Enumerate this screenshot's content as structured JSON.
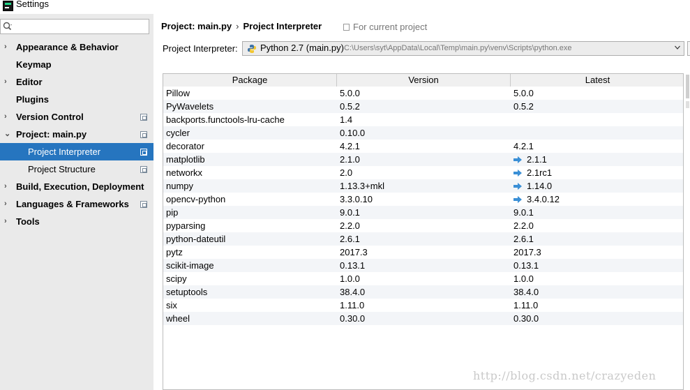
{
  "window": {
    "title": "Settings"
  },
  "search": {
    "value": "",
    "placeholder": ""
  },
  "sidebar": {
    "items": [
      {
        "label": "Appearance & Behavior",
        "arrow": "›"
      },
      {
        "label": "Keymap",
        "arrow": ""
      },
      {
        "label": "Editor",
        "arrow": "›"
      },
      {
        "label": "Plugins",
        "arrow": ""
      },
      {
        "label": "Version Control",
        "arrow": "›"
      },
      {
        "label": "Project: main.py",
        "arrow": "⌄"
      },
      {
        "label": "Project Interpreter",
        "arrow": ""
      },
      {
        "label": "Project Structure",
        "arrow": ""
      },
      {
        "label": "Build, Execution, Deployment",
        "arrow": "›"
      },
      {
        "label": "Languages & Frameworks",
        "arrow": "›"
      },
      {
        "label": "Tools",
        "arrow": "›"
      }
    ],
    "selected": "Project Interpreter"
  },
  "header": {
    "crumb1": "Project: main.py",
    "separator": "›",
    "crumb2": "Project Interpreter",
    "scope_hint": "For current project"
  },
  "interpreter": {
    "label": "Project Interpreter:",
    "name": "Python 2.7 (main.py)",
    "path": "C:\\Users\\syt\\AppData\\Local\\Temp\\main.py\\venv\\Scripts\\python.exe"
  },
  "table": {
    "columns": [
      "Package",
      "Version",
      "Latest"
    ],
    "rows": [
      {
        "package": "Pillow",
        "version": "5.0.0",
        "latest": "5.0.0",
        "upgrade": false
      },
      {
        "package": "PyWavelets",
        "version": "0.5.2",
        "latest": "0.5.2",
        "upgrade": false
      },
      {
        "package": "backports.functools-lru-cache",
        "version": "1.4",
        "latest": "",
        "upgrade": false
      },
      {
        "package": "cycler",
        "version": "0.10.0",
        "latest": "",
        "upgrade": false
      },
      {
        "package": "decorator",
        "version": "4.2.1",
        "latest": "4.2.1",
        "upgrade": false
      },
      {
        "package": "matplotlib",
        "version": "2.1.0",
        "latest": "2.1.1",
        "upgrade": true
      },
      {
        "package": "networkx",
        "version": "2.0",
        "latest": "2.1rc1",
        "upgrade": true
      },
      {
        "package": "numpy",
        "version": "1.13.3+mkl",
        "latest": "1.14.0",
        "upgrade": true
      },
      {
        "package": "opencv-python",
        "version": "3.3.0.10",
        "latest": "3.4.0.12",
        "upgrade": true
      },
      {
        "package": "pip",
        "version": "9.0.1",
        "latest": "9.0.1",
        "upgrade": false
      },
      {
        "package": "pyparsing",
        "version": "2.2.0",
        "latest": "2.2.0",
        "upgrade": false
      },
      {
        "package": "python-dateutil",
        "version": "2.6.1",
        "latest": "2.6.1",
        "upgrade": false
      },
      {
        "package": "pytz",
        "version": "2017.3",
        "latest": "2017.3",
        "upgrade": false
      },
      {
        "package": "scikit-image",
        "version": "0.13.1",
        "latest": "0.13.1",
        "upgrade": false
      },
      {
        "package": "scipy",
        "version": "1.0.0",
        "latest": "1.0.0",
        "upgrade": false
      },
      {
        "package": "setuptools",
        "version": "38.4.0",
        "latest": "38.4.0",
        "upgrade": false
      },
      {
        "package": "six",
        "version": "1.11.0",
        "latest": "1.11.0",
        "upgrade": false
      },
      {
        "package": "wheel",
        "version": "0.30.0",
        "latest": "0.30.0",
        "upgrade": false
      }
    ]
  },
  "watermark": "http://blog.csdn.net/crazyeden",
  "colors": {
    "selection": "#2675bf",
    "sidebar_bg": "#eaeaea",
    "upgrade_arrow": "#3a8fd6"
  }
}
